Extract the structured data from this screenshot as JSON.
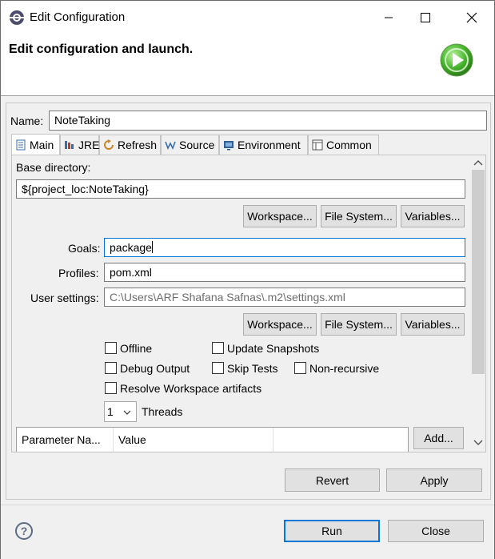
{
  "window": {
    "title": "Edit Configuration",
    "controls": [
      "minimize-icon",
      "maximize-icon",
      "close-icon"
    ]
  },
  "header": {
    "title": "Edit configuration and launch.",
    "icon": "run-icon"
  },
  "name_field": {
    "label": "Name:",
    "value": "NoteTaking"
  },
  "tabs": [
    {
      "label": "Main",
      "icon": "main-tab-icon",
      "active": true
    },
    {
      "label": "JRE",
      "icon": "jre-icon"
    },
    {
      "label": "Refresh",
      "icon": "refresh-icon"
    },
    {
      "label": "Source",
      "icon": "source-icon"
    },
    {
      "label": "Environment",
      "icon": "environment-icon"
    },
    {
      "label": "Common",
      "icon": "common-icon"
    }
  ],
  "main": {
    "base_directory_label": "Base directory:",
    "base_directory_value": "${project_loc:NoteTaking}",
    "buttons1": {
      "workspace": "Workspace...",
      "filesystem": "File System...",
      "variables": "Variables..."
    },
    "goals_label": "Goals:",
    "goals_value": "package",
    "profiles_label": "Profiles:",
    "profiles_value": "pom.xml",
    "user_settings_label": "User settings:",
    "user_settings_value": "C:\\Users\\ARF Shafana Safnas\\.m2\\settings.xml",
    "buttons2": {
      "workspace": "Workspace...",
      "filesystem": "File System...",
      "variables": "Variables..."
    },
    "checkboxes": {
      "offline": "Offline",
      "update_snapshots": "Update Snapshots",
      "debug_output": "Debug Output",
      "skip_tests": "Skip Tests",
      "non_recursive": "Non-recursive",
      "resolve_workspace": "Resolve Workspace artifacts"
    },
    "threads_value": "1",
    "threads_label": "Threads",
    "table_headers": [
      "Parameter Na...",
      "Value"
    ],
    "add_button": "Add..."
  },
  "footer": {
    "revert": "Revert",
    "apply": "Apply",
    "run": "Run",
    "close": "Close",
    "help": "?"
  },
  "colors": {
    "focus_border": "#0078d7",
    "run_green": "#3fae2a"
  }
}
